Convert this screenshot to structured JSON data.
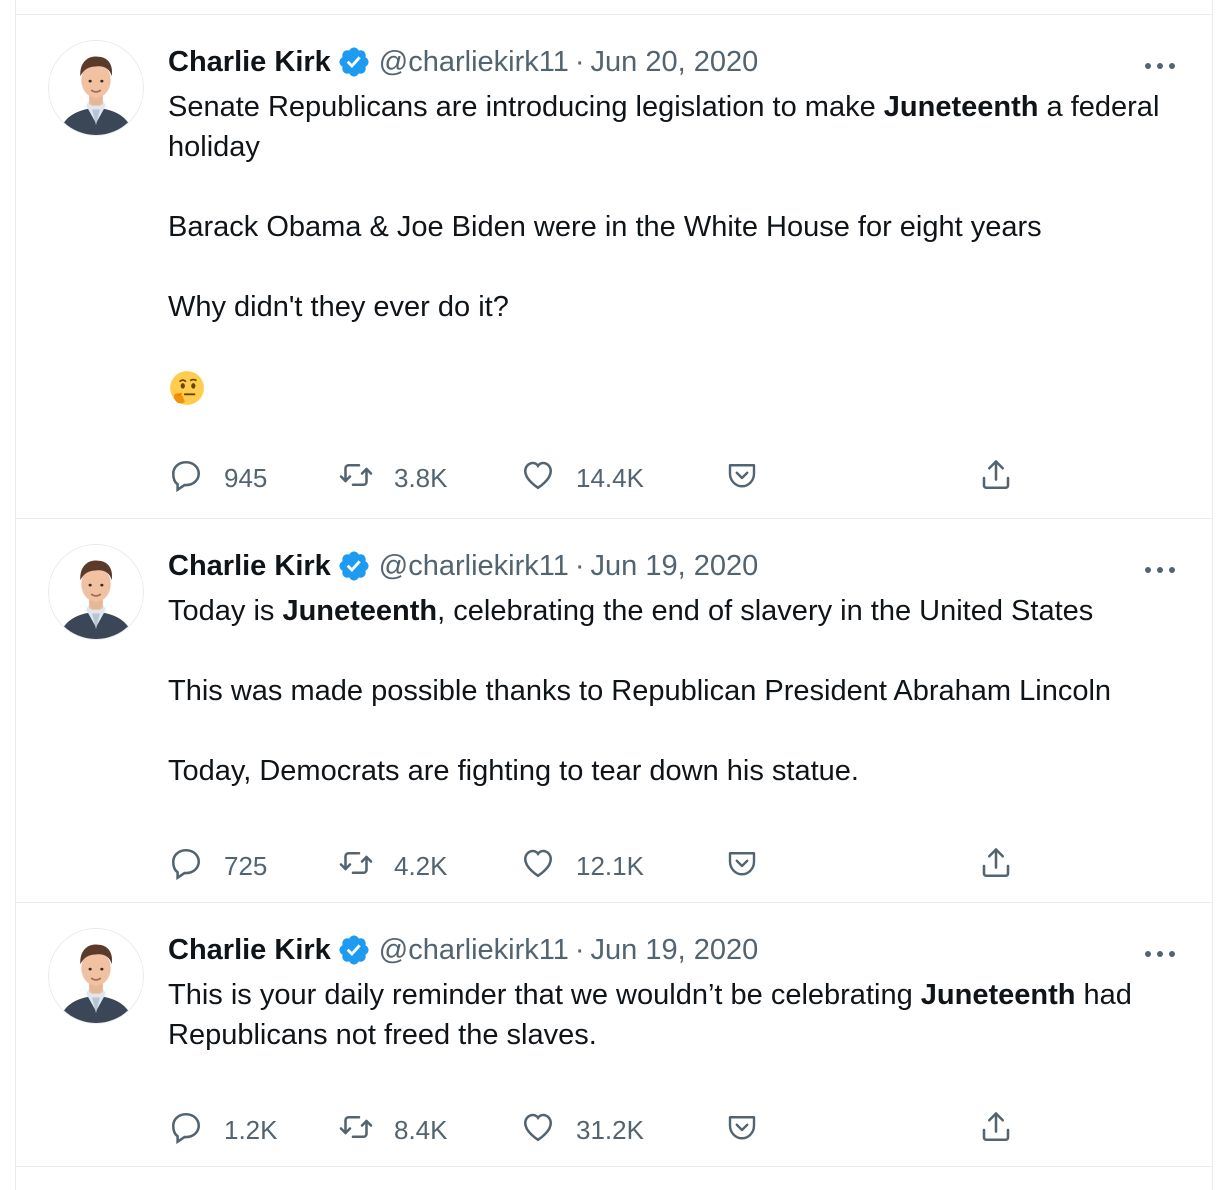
{
  "tweets": [
    {
      "name": "Charlie Kirk",
      "handle": "@charliekirk11",
      "separator": "·",
      "date": "Jun 20, 2020",
      "paragraphs": [
        {
          "parts": [
            {
              "t": "Senate Republicans are introducing legislation to make "
            },
            {
              "t": "Juneteenth",
              "b": true
            },
            {
              "t": " a federal holiday"
            }
          ]
        },
        {
          "parts": [
            {
              "t": "Barack Obama & Joe Biden were in the White House for eight years"
            }
          ]
        },
        {
          "parts": [
            {
              "t": "Why didn't they ever do it?"
            }
          ]
        },
        {
          "emoji": "thinking-face"
        }
      ],
      "replies": "945",
      "retweets": "3.8K",
      "likes": "14.4K"
    },
    {
      "name": "Charlie Kirk",
      "handle": "@charliekirk11",
      "separator": "·",
      "date": "Jun 19, 2020",
      "paragraphs": [
        {
          "parts": [
            {
              "t": "Today is "
            },
            {
              "t": "Juneteenth",
              "b": true
            },
            {
              "t": ", celebrating the end of slavery in the United States"
            }
          ]
        },
        {
          "parts": [
            {
              "t": "This was made possible thanks to Republican President Abraham Lincoln"
            }
          ]
        },
        {
          "parts": [
            {
              "t": "Today, Democrats are fighting to tear down his statue."
            }
          ]
        }
      ],
      "replies": "725",
      "retweets": "4.2K",
      "likes": "12.1K"
    },
    {
      "name": "Charlie Kirk",
      "handle": "@charliekirk11",
      "separator": "·",
      "date": "Jun 19, 2020",
      "paragraphs": [
        {
          "parts": [
            {
              "t": "This is your daily reminder that we wouldn’t be celebrating "
            },
            {
              "t": "Juneteenth",
              "b": true
            },
            {
              "t": " had Republicans not freed the slaves."
            }
          ]
        }
      ],
      "replies": "1.2K",
      "retweets": "8.4K",
      "likes": "31.2K"
    }
  ],
  "colors": {
    "verified": "#1d9bf0",
    "muted": "#536471",
    "text": "#0f1419",
    "border": "#e6ecf0"
  },
  "icons": [
    "verified-badge-icon",
    "more-options-icon",
    "reply-icon",
    "retweet-icon",
    "like-icon",
    "save-pocket-icon",
    "share-icon",
    "thinking-face-emoji"
  ]
}
